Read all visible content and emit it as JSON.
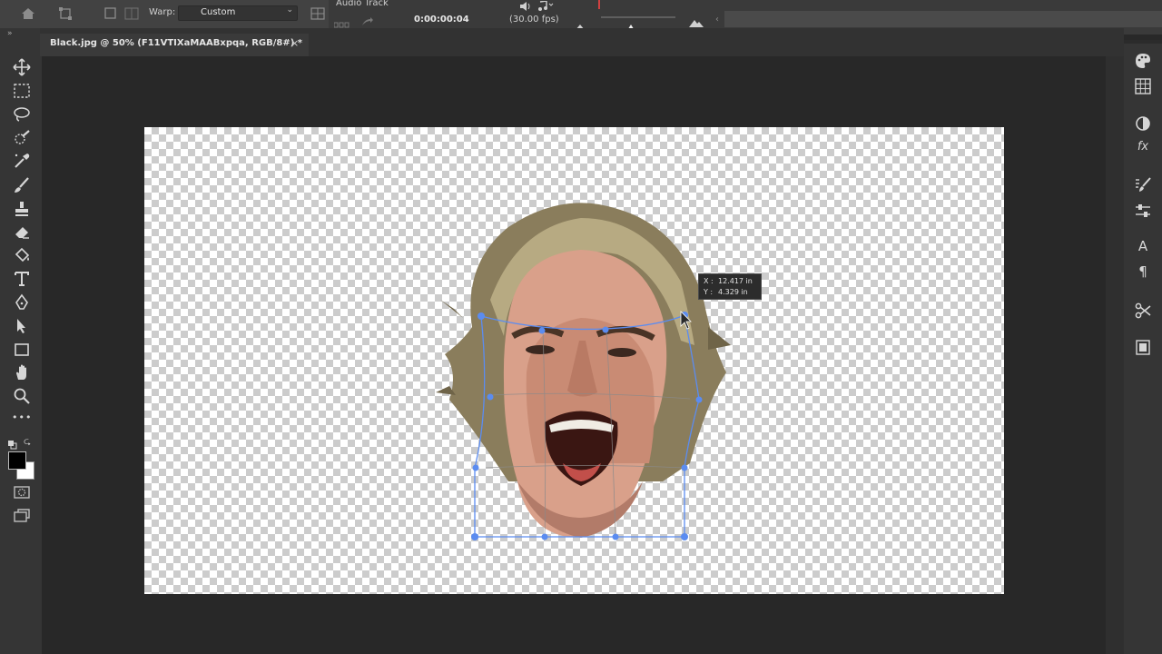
{
  "options_bar": {
    "warp_label": "Warp:",
    "warp_mode": "Custom"
  },
  "timeline": {
    "track_label": "Audio Track",
    "timecode": "0:00:00:04",
    "fps": "(30.00 fps)"
  },
  "document_tab": {
    "title": "Black.jpg @ 50% (F11VTIXaMAABxpqa, RGB/8#) *",
    "close_glyph": "×"
  },
  "tooltip": {
    "x_label": "X :",
    "x_value": "12.417 in",
    "y_label": "Y :",
    "y_value": "4.329 in"
  },
  "toolbar": {
    "tools": [
      "move-tool",
      "marquee-tool",
      "lasso-tool",
      "quick-selection-tool",
      "eyedropper-tool",
      "brush-tool",
      "stamp-tool",
      "eraser-tool",
      "paint-bucket-tool",
      "type-tool",
      "pen-tool",
      "path-selection-tool",
      "rectangle-tool",
      "hand-tool",
      "zoom-tool",
      "more-tools"
    ],
    "foreground_color": "#000000",
    "background_color": "#ffffff",
    "more_glyph": "•••"
  },
  "right_panel": {
    "icons": [
      "color-palette-icon",
      "swatches-grid-icon",
      "adjustments-icon",
      "styles-fx-icon",
      "brush-settings-icon",
      "properties-sliders-icon",
      "character-icon",
      "paragraph-icon",
      "tools-scissor-icon",
      "libraries-icon"
    ],
    "character_glyph": "A",
    "paragraph_glyph": "¶",
    "fx_glyph": "fx"
  },
  "colors": {
    "accent_warp": "#5b8cf0",
    "ui_dark": "#282828",
    "ui_panel": "#353535"
  }
}
